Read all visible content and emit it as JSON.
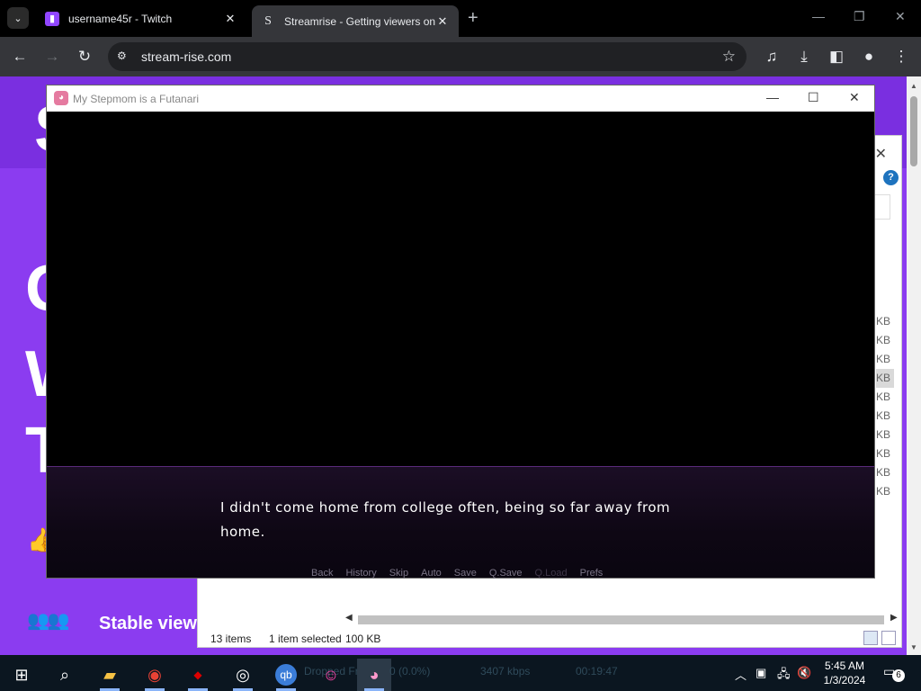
{
  "browser": {
    "tabs": [
      {
        "title": "username45r - Twitch",
        "favicon": "twitch-icon"
      },
      {
        "title": "Streamrise - Getting viewers on",
        "favicon": "S"
      }
    ],
    "url": "stream-rise.com"
  },
  "page": {
    "headline_fragments": [
      "S",
      "G",
      "W",
      "T"
    ],
    "stable_label": "Stable view"
  },
  "explorer": {
    "sizes": [
      "KB",
      "KB",
      "KB",
      "KB",
      "KB",
      "KB",
      "KB",
      "KB",
      "KB",
      "KB"
    ],
    "help": "?",
    "status": {
      "items": "13 items",
      "selected": "1 item selected",
      "size": "100 KB"
    }
  },
  "game": {
    "window_title": "My Stepmom is a Futanari",
    "dialogue": "I didn't come home from college often, being so far away from home.",
    "quick_menu": [
      "Back",
      "History",
      "Skip",
      "Auto",
      "Save",
      "Q.Save",
      "Q.Load",
      "Prefs"
    ]
  },
  "taskbar": {
    "obs": {
      "dropped": "Dropped Fr",
      "dropped_pct": "0 (0.0%)",
      "bitrate": "3407 kbps",
      "time": "00:19:47"
    },
    "clock": {
      "time": "5:45 AM",
      "date": "1/3/2024"
    },
    "notification_count": "6"
  },
  "colors": {
    "accent": "#8b3cf0",
    "chrome_bg": "#35363a",
    "taskbar": "#0b1620"
  }
}
